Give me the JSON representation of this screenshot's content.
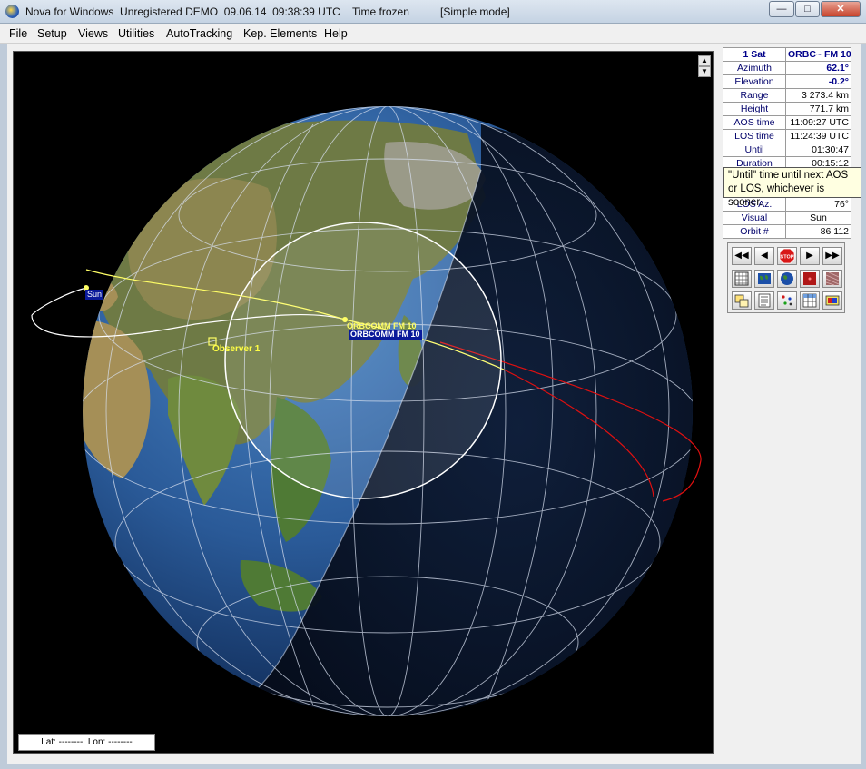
{
  "window": {
    "title": "Nova for Windows  Unregistered DEMO  09.06.14  09:38:39 UTC",
    "time_status": "Time frozen",
    "mode": "[Simple mode]"
  },
  "menu": [
    "File",
    "Setup",
    "Views",
    "Utilities",
    "AutoTracking",
    "Kep. Elements",
    "Help"
  ],
  "info": {
    "header_left": "1 Sat",
    "header_right": "ORBC~ FM 10",
    "rows": [
      {
        "label": "Azimuth",
        "value": "62.1°"
      },
      {
        "label": "Elevation",
        "value": "-0.2°"
      },
      {
        "label": "Range",
        "value": "3 273.4 km"
      },
      {
        "label": "Height",
        "value": "771.7 km"
      },
      {
        "label": "AOS time",
        "value": "11:09:27 UTC"
      },
      {
        "label": "LOS time",
        "value": "11:24:39 UTC"
      },
      {
        "label": "Until",
        "value": "01:30:47"
      },
      {
        "label": "Duration",
        "value": "00:15:12"
      },
      {
        "label": "",
        "value": ""
      },
      {
        "label": "",
        "value": ""
      },
      {
        "label": "LOS Az.",
        "value": "76°"
      },
      {
        "label": "Visual",
        "value": "Sun"
      },
      {
        "label": "Orbit #",
        "value": "86 112"
      }
    ]
  },
  "tooltip": {
    "line1": "\"Until\" time until next AOS",
    "line2": "or LOS, whichever is sooner."
  },
  "map": {
    "sun_label": "Sun",
    "sat_label": "ORBCOMM FM 10",
    "sat_label_selected": "ORBCOMM FM 10",
    "observer_label": "Observer 1",
    "status": "Lat: --------  Lon: --------"
  },
  "toolbar": {
    "row1": [
      "rewind-icon",
      "step-back-icon",
      "stop-icon",
      "step-forward-icon",
      "fast-forward-icon"
    ],
    "row2": [
      "grid-view-icon",
      "flat-map-icon",
      "globe-icon",
      "radar-icon",
      "noise-icon"
    ],
    "row3": [
      "windows-icon",
      "list-icon",
      "satellites-icon",
      "table-icon",
      "palette-icon"
    ],
    "stop_label": "STOP"
  },
  "colors": {
    "title_bg": "#c8d6e6",
    "menu_bg": "#f0f0f0",
    "map_bg": "#000000",
    "selected_label_bg": "#0a246a",
    "tooltip_bg": "#ffffe1",
    "orbit_sunlit": "#ffff66",
    "orbit_shadow": "#e01010"
  }
}
